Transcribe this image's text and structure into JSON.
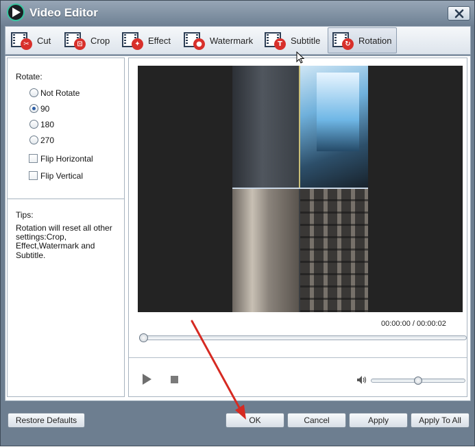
{
  "window": {
    "title": "Video Editor"
  },
  "toolbar": {
    "tools": [
      {
        "label": "Cut",
        "icon": "scissors-icon"
      },
      {
        "label": "Crop",
        "icon": "crop-icon"
      },
      {
        "label": "Effect",
        "icon": "magic-wand-icon"
      },
      {
        "label": "Watermark",
        "icon": "droplet-icon"
      },
      {
        "label": "Subtitle",
        "icon": "text-t-icon"
      },
      {
        "label": "Rotation",
        "icon": "rotate-icon"
      }
    ],
    "active_tool": "Rotation"
  },
  "rotation_panel": {
    "rotate_label": "Rotate:",
    "options": [
      "Not Rotate",
      "90",
      "180",
      "270"
    ],
    "selected": "90",
    "flip_horizontal": {
      "label": "Flip Horizontal",
      "checked": false
    },
    "flip_vertical": {
      "label": "Flip Vertical",
      "checked": false
    },
    "tips_label": "Tips:",
    "tips_text_1": "Rotation will reset all other",
    "tips_text_2": "settings:Crop,",
    "tips_text_3": "Effect,Watermark and Subtitle."
  },
  "player": {
    "current_time": "00:00:00",
    "separator": "/",
    "total_time": "00:00:02",
    "progress": 0,
    "volume": 0.55
  },
  "footer": {
    "restore_defaults": "Restore Defaults",
    "ok": "OK",
    "cancel": "Cancel",
    "apply": "Apply",
    "apply_to_all": "Apply To All"
  },
  "colors": {
    "title_bar": "#7f8fa2",
    "accent_blue": "#2e5fa6",
    "annotation_red": "#d62a22"
  }
}
